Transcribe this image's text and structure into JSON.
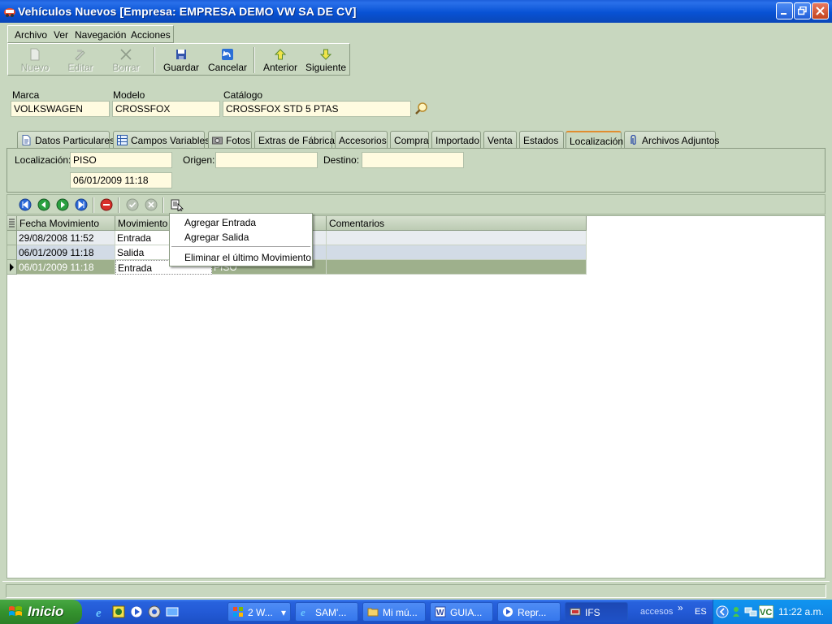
{
  "window": {
    "title": "Vehículos Nuevos [Empresa: EMPRESA DEMO VW SA DE CV]"
  },
  "menu": {
    "items": [
      "Archivo",
      "Ver",
      "Navegación",
      "Acciones"
    ]
  },
  "toolbar": {
    "nuevo": "Nuevo",
    "editar": "Editar",
    "borrar": "Borrar",
    "guardar": "Guardar",
    "cancelar": "Cancelar",
    "anterior": "Anterior",
    "siguiente": "Siguiente"
  },
  "header_fields": {
    "marca_label": "Marca",
    "marca_value": "VOLKSWAGEN",
    "modelo_label": "Modelo",
    "modelo_value": "CROSSFOX",
    "catalogo_label": "Catálogo",
    "catalogo_value": "CROSSFOX  STD 5 PTAS"
  },
  "tabs": [
    {
      "label": "Datos Particulares"
    },
    {
      "label": "Campos Variables"
    },
    {
      "label": "Fotos"
    },
    {
      "label": "Extras de Fábrica"
    },
    {
      "label": "Accesorios"
    },
    {
      "label": "Compra"
    },
    {
      "label": "Importado"
    },
    {
      "label": "Venta"
    },
    {
      "label": "Estados"
    },
    {
      "label": "Localización"
    },
    {
      "label": "Archivos Adjuntos"
    }
  ],
  "location": {
    "localizacion_label": "Localización:",
    "localizacion_value": "PISO",
    "fecha_value": "06/01/2009 11:18",
    "origen_label": "Origen:",
    "origen_value": "",
    "destino_label": "Destino:",
    "destino_value": ""
  },
  "grid": {
    "columns": [
      "Fecha Movimiento",
      "Movimiento",
      "Comentarios"
    ],
    "rows": [
      {
        "fecha": "29/08/2008 11:52",
        "movimiento": "Entrada",
        "destino": "",
        "comentarios": ""
      },
      {
        "fecha": "06/01/2009 11:18",
        "movimiento": "Salida",
        "destino": "",
        "comentarios": ""
      },
      {
        "fecha": "06/01/2009 11:18",
        "movimiento": "Entrada",
        "destino": "PISO",
        "comentarios": ""
      }
    ]
  },
  "context_menu": {
    "agregar_entrada": "Agregar Entrada",
    "agregar_salida": "Agregar Salida",
    "eliminar": "Eliminar el último Movimiento"
  },
  "taskbar": {
    "start_label": "Inicio",
    "tasks": [
      "2 W...",
      "SAM'...",
      "Mi mú...",
      "GUIA...",
      "Repr...",
      "IFS"
    ],
    "accesos": "accesos",
    "lang": "ES",
    "clock": "11:22 a.m."
  },
  "colors": {
    "title_blue": "#0a53d6",
    "window_bg": "#c8d7bf",
    "field_bg": "#fffbe0",
    "selected_row": "#9eb08c",
    "taskbar_blue": "#235ad6",
    "start_green": "#34922e",
    "active_tab_accent": "#e08d30"
  }
}
